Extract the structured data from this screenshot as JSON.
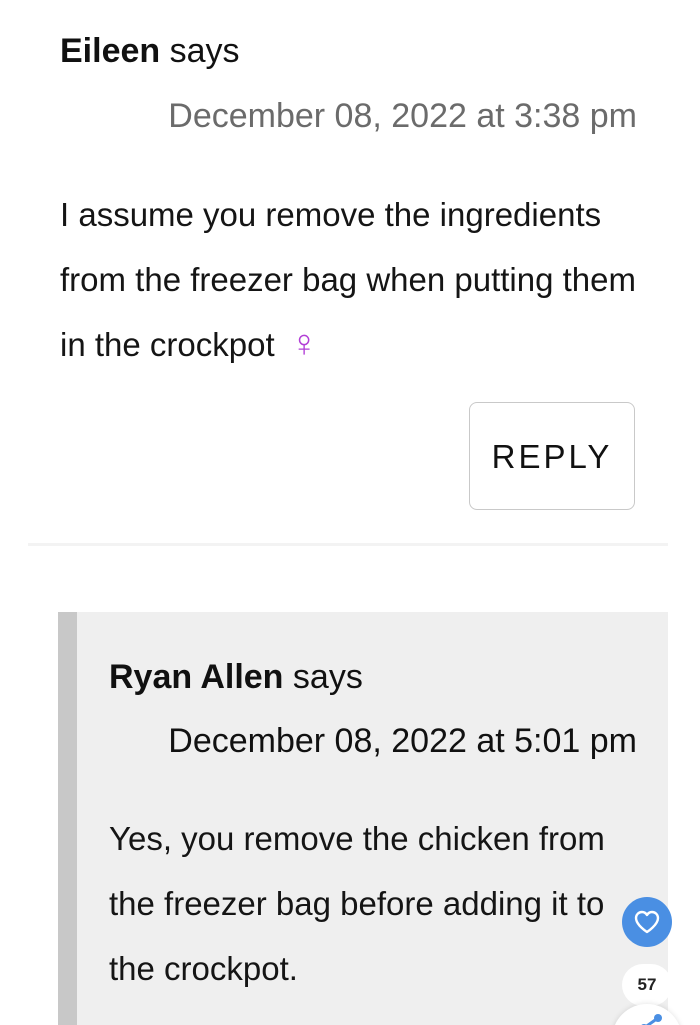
{
  "comment": {
    "author": "Eileen",
    "says": "says",
    "timestamp": "December 08, 2022 at 3:38 pm",
    "body": "I assume you remove the ingredients from the freezer bag when putting them in the crockpot",
    "emoji": "♀",
    "reply_label": "REPLY"
  },
  "reply": {
    "author": "Ryan Allen",
    "says": "says",
    "timestamp": "December 08, 2022 at 5:01 pm",
    "body": "Yes, you remove the chicken from the freezer bag before adding it to the crockpot."
  },
  "floating": {
    "like_count": "57",
    "heart_icon": "heart-icon",
    "share_icon": "share-icon",
    "accent_color": "#4a8fe3"
  }
}
